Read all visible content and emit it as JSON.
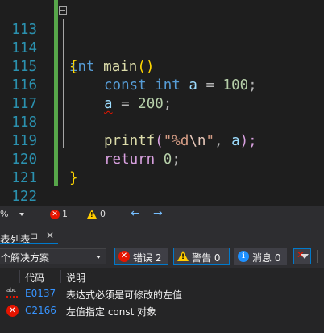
{
  "editor": {
    "lines": [
      {
        "number": "113"
      },
      {
        "number": "114"
      },
      {
        "number": "115"
      },
      {
        "number": "116"
      },
      {
        "number": "117"
      },
      {
        "number": "118"
      },
      {
        "number": "119"
      },
      {
        "number": "120"
      },
      {
        "number": "121"
      },
      {
        "number": "122"
      }
    ],
    "code": {
      "l113_type": "int",
      "l113_func": "main",
      "l113_parens": "()",
      "l114_brace": "{",
      "l115_const": "const",
      "l115_type": "int",
      "l115_var": "a",
      "l115_eq": " = ",
      "l115_num": "100",
      "l115_semi": ";",
      "l116_var": "a",
      "l116_eq": " = ",
      "l116_num": "200",
      "l116_semi": ";",
      "l118_func": "printf",
      "l118_open": "(",
      "l118_str1": "\"%d",
      "l118_esc": "\\n",
      "l118_str2": "\"",
      "l118_comma": ", ",
      "l118_var": "a",
      "l118_close": ");",
      "l119_return": "return",
      "l119_num": "0",
      "l119_semi": ";",
      "l120_brace": "}"
    }
  },
  "status_strip": {
    "zoom": "%",
    "errors": "1",
    "warnings": "0",
    "nav_back": "←",
    "nav_forward": "→"
  },
  "error_list": {
    "tab": {
      "label": "表列表",
      "pin": "⊐",
      "close": "✕"
    },
    "scope_dropdown": "个解决方案",
    "filters": {
      "errors": "错误 2",
      "warnings": "警告 0",
      "messages": "消息 0"
    },
    "columns": {
      "code": "代码",
      "description": "说明"
    },
    "rows": [
      {
        "icon": "spelling-abc-icon",
        "abc": "abc",
        "code": "E0137",
        "description": "表达式必须是可修改的左值"
      },
      {
        "icon": "error-icon",
        "code": "C2166",
        "description": "左值指定 const 对象"
      }
    ]
  },
  "colors": {
    "error": "#e51400",
    "warning": "#ffcc00",
    "info": "#1e90ff",
    "accent": "#007acc",
    "line_number": "#2b91af",
    "change_bar": "#57a64a"
  }
}
